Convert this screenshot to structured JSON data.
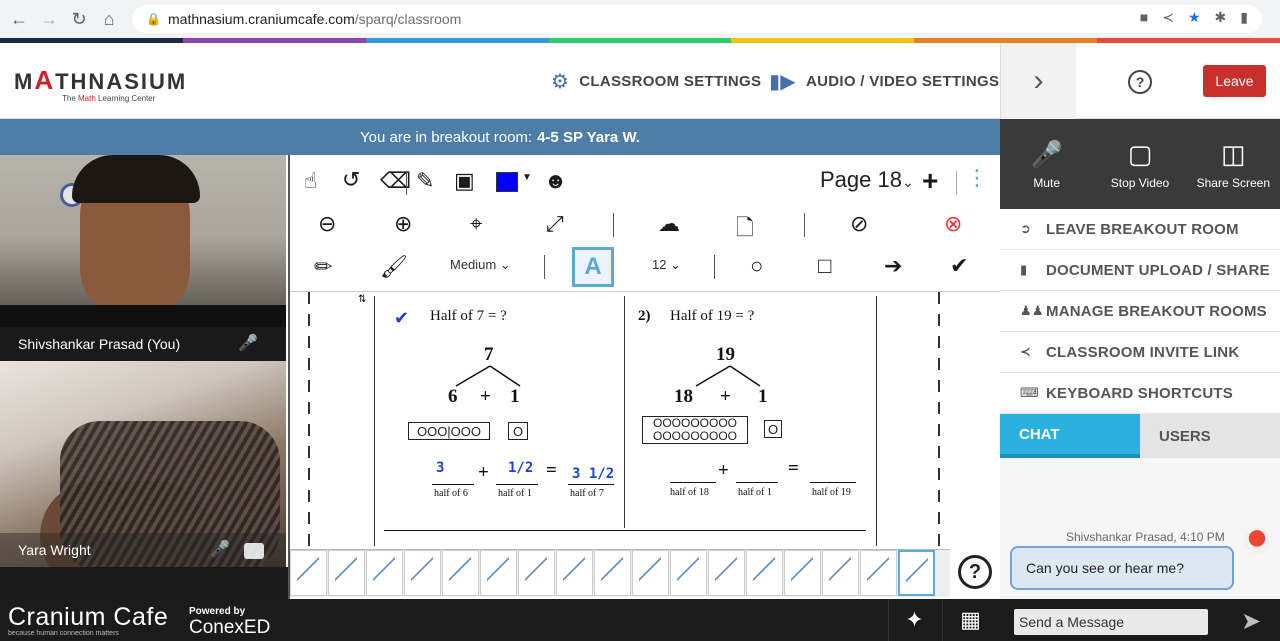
{
  "browser": {
    "url_domain": "mathnasium.craniumcafe.com",
    "url_path": "/sparq/classroom"
  },
  "stripe_colors": [
    "#1f2a44",
    "#8e44ad",
    "#3498db",
    "#2ecc71",
    "#f1c40f",
    "#e67e22",
    "#e74c3c"
  ],
  "logo": {
    "wordmark_pre": "M",
    "wordmark_a": "A",
    "wordmark_post": "THNASIUM",
    "tagline_pre": "The ",
    "tagline_math": "Math",
    "tagline_post": " Learning Center"
  },
  "header": {
    "classroom_settings": "CLASSROOM SETTINGS",
    "av_settings": "AUDIO / VIDEO SETTINGS",
    "help": "?",
    "leave": "Leave"
  },
  "banner": {
    "prefix": "You are in breakout room:",
    "room": "4-5 SP Yara W."
  },
  "tiles": [
    {
      "name": "Shivshankar Prasad (You)"
    },
    {
      "name": "Yara Wright"
    }
  ],
  "whiteboard": {
    "page_label": "Page 18",
    "stroke": "Medium",
    "font_size": "12",
    "text_tool": "A",
    "pen_color": "#0000ff"
  },
  "worksheet": {
    "q1_prompt": "Half of 7 = ?",
    "q1_total": "7",
    "q1_left": "6",
    "q1_plus": "+",
    "q1_right": "1",
    "q1_beads_left": "OOO|OOO",
    "q1_beads_right": "O",
    "q1_ans_a": "3",
    "q1_ans_b": "1/2",
    "q1_ans_c": "3 1/2",
    "q1_sub_a": "half of 6",
    "q1_sub_b": "half of 1",
    "q1_sub_c": "half of 7",
    "q2_num": "2)",
    "q2_prompt": "Half of 19 = ?",
    "q2_total": "19",
    "q2_left": "18",
    "q2_plus": "+",
    "q2_right": "1",
    "q2_beads_left_row1": "OOOOOOOOO",
    "q2_beads_left_row2": "OOOOOOOOO",
    "q2_beads_right": "O",
    "q2_sub_a": "half of 18",
    "q2_sub_b": "half of 1",
    "q2_sub_c": "half of 19",
    "eq": "="
  },
  "thumbnails": {
    "count": 17,
    "active_index": 16
  },
  "av_controls": {
    "mute": "Mute",
    "stop_video": "Stop Video",
    "share_screen": "Share Screen"
  },
  "room_menu": [
    {
      "label": "LEAVE BREAKOUT ROOM"
    },
    {
      "label": "DOCUMENT UPLOAD / SHARE"
    },
    {
      "label": "MANAGE BREAKOUT ROOMS"
    },
    {
      "label": "CLASSROOM INVITE LINK"
    },
    {
      "label": "KEYBOARD SHORTCUTS"
    }
  ],
  "chat": {
    "tab_chat": "CHAT",
    "tab_users": "USERS",
    "message_meta": "Shivshankar Prasad, 4:10 PM",
    "message_text": "Can you see or hear me?",
    "input_placeholder": "Send a Message"
  },
  "footer": {
    "brand": "Cranium Cafe",
    "brand_tag": "because human connection matters",
    "powered_label": "Powered by",
    "powered_brand": "ConexED"
  }
}
